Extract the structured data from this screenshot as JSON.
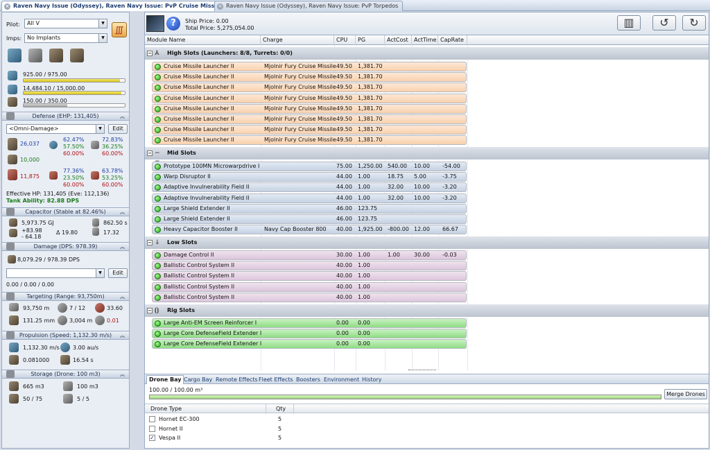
{
  "tabs": [
    {
      "label": "Raven Navy Issue (Odyssey), Raven Navy Issue: PvP Cruise Missiles",
      "active": true
    },
    {
      "label": "Raven Navy Issue (Odyssey), Raven Navy Issue: PvP Torpedos",
      "active": false
    }
  ],
  "left": {
    "pilot_label": "Pilot:",
    "pilot_value": "All V",
    "imps_label": "Imps:",
    "imps_value": "No Implants",
    "cpu": "925.00 / 975.00",
    "cpu_fill": 0.949,
    "pg": "14,484.10 / 15,000.00",
    "pg_fill": 0.966,
    "calibration": "150.00 / 350.00",
    "calibration_fill": 0.429,
    "defense": {
      "header": "Defense (EHP: 131,405)",
      "profile": "<Omni-Damage>",
      "edit_label": "Edit",
      "shield_hp": "26,037",
      "shield_em": "62.47%",
      "shield_th": "57.50%",
      "shield_ki": "60.00%",
      "shield_ex": "72.83%",
      "shield_ex2": "36.25%",
      "shield_ex3": "60.00%",
      "armor_hp": "10,000",
      "hull_hp": "11,875",
      "hull_a": "77.36%",
      "hull_b": "23.50%",
      "hull_c": "60.00%",
      "hull_d": "63.78%",
      "hull_e": "53.25%",
      "hull_f": "60.00%",
      "effective": "Effective HP: 131,405 (Eve: 112,136)",
      "tank": "Tank Ability: 82.88 DPS"
    },
    "capacitor": {
      "header": "Capacitor (Stable at 82.46%)",
      "capacity": "5,973.75 GJ",
      "recharge": "862.50 s",
      "delta_pos": "+83.98",
      "delta_neg": "- 64.18",
      "delta": "Δ 19.80",
      "other": "17.32"
    },
    "damage": {
      "header": "Damage (DPS: 978.39)",
      "dps": "8,079.29 / 978.39 DPS",
      "edit_label": "Edit",
      "secondary": "0.00 / 0.00 / 0.00"
    },
    "targeting": {
      "header": "Targeting (Range: 93,750m)",
      "range": "93,750 m",
      "targets": "7 / 12",
      "sensor": "33.60",
      "scan_res": "131.25 mm",
      "sig": "3,004 m",
      "sig_rate": "0.01"
    },
    "propulsion": {
      "header": "Propulsion (Speed: 1,132.30 m/s)",
      "speed": "1,132.30 m/s",
      "warp": "3.00 au/s",
      "agility": "0.081000",
      "align": "16.54 s"
    },
    "storage": {
      "header": "Storage (Drone: 100 m3)",
      "cargo": "665 m3",
      "drone_bay": "100 m3",
      "bandwidth": "50 / 75",
      "drones": "5 / 5"
    }
  },
  "right": {
    "ship_price": "Ship Price: 0.00",
    "total_price": "Total Price: 5,275,054.00",
    "columns": [
      "Module Name",
      "Charge",
      "CPU",
      "PG",
      "ActCost",
      "ActTime",
      "CapRate"
    ],
    "high_header": "High Slots (Launchers: 8/8, Turrets: 0/0)",
    "mid_header": "Mid Slots",
    "low_header": "Low Slots",
    "rig_header": "Rig Slots",
    "high": [
      {
        "name": "Cruise Missile Launcher II",
        "charge": "Mjolnir Fury Cruise Missile",
        "cpu": "49.50",
        "pg": "1,381.70",
        "cost": "",
        "time": "",
        "rate": ""
      },
      {
        "name": "Cruise Missile Launcher II",
        "charge": "Mjolnir Fury Cruise Missile",
        "cpu": "49.50",
        "pg": "1,381.70",
        "cost": "",
        "time": "",
        "rate": ""
      },
      {
        "name": "Cruise Missile Launcher II",
        "charge": "Mjolnir Fury Cruise Missile",
        "cpu": "49.50",
        "pg": "1,381.70",
        "cost": "",
        "time": "",
        "rate": ""
      },
      {
        "name": "Cruise Missile Launcher II",
        "charge": "Mjolnir Fury Cruise Missile",
        "cpu": "49.50",
        "pg": "1,381.70",
        "cost": "",
        "time": "",
        "rate": ""
      },
      {
        "name": "Cruise Missile Launcher II",
        "charge": "Mjolnir Fury Cruise Missile",
        "cpu": "49.50",
        "pg": "1,381.70",
        "cost": "",
        "time": "",
        "rate": ""
      },
      {
        "name": "Cruise Missile Launcher II",
        "charge": "Mjolnir Fury Cruise Missile",
        "cpu": "49.50",
        "pg": "1,381.70",
        "cost": "",
        "time": "",
        "rate": ""
      },
      {
        "name": "Cruise Missile Launcher II",
        "charge": "Mjolnir Fury Cruise Missile",
        "cpu": "49.50",
        "pg": "1,381.70",
        "cost": "",
        "time": "",
        "rate": ""
      },
      {
        "name": "Cruise Missile Launcher II",
        "charge": "Mjolnir Fury Cruise Missile",
        "cpu": "49.50",
        "pg": "1,381.70",
        "cost": "",
        "time": "",
        "rate": ""
      }
    ],
    "mid": [
      {
        "name": "Prototype 100MN Microwarpdrive I",
        "charge": "",
        "cpu": "75.00",
        "pg": "1,250.00",
        "cost": "540.00",
        "time": "10.00",
        "rate": "-54.00"
      },
      {
        "name": "Warp Disruptor II",
        "charge": "",
        "cpu": "44.00",
        "pg": "1.00",
        "cost": "18.75",
        "time": "5.00",
        "rate": "-3.75"
      },
      {
        "name": "Adaptive Invulnerability Field II",
        "charge": "",
        "cpu": "44.00",
        "pg": "1.00",
        "cost": "32.00",
        "time": "10.00",
        "rate": "-3.20"
      },
      {
        "name": "Adaptive Invulnerability Field II",
        "charge": "",
        "cpu": "44.00",
        "pg": "1.00",
        "cost": "32.00",
        "time": "10.00",
        "rate": "-3.20"
      },
      {
        "name": "Large Shield Extender II",
        "charge": "",
        "cpu": "46.00",
        "pg": "123.75",
        "cost": "",
        "time": "",
        "rate": ""
      },
      {
        "name": "Large Shield Extender II",
        "charge": "",
        "cpu": "46.00",
        "pg": "123.75",
        "cost": "",
        "time": "",
        "rate": ""
      },
      {
        "name": "Heavy Capacitor Booster II",
        "charge": "Navy Cap Booster 800",
        "cpu": "40.00",
        "pg": "1,925.00",
        "cost": "-800.00",
        "time": "12.00",
        "rate": "66.67"
      }
    ],
    "low": [
      {
        "name": "Damage Control II",
        "charge": "",
        "cpu": "30.00",
        "pg": "1.00",
        "cost": "1.00",
        "time": "30.00",
        "rate": "-0.03"
      },
      {
        "name": "Ballistic Control System II",
        "charge": "",
        "cpu": "40.00",
        "pg": "1.00",
        "cost": "",
        "time": "",
        "rate": ""
      },
      {
        "name": "Ballistic Control System II",
        "charge": "",
        "cpu": "40.00",
        "pg": "1.00",
        "cost": "",
        "time": "",
        "rate": ""
      },
      {
        "name": "Ballistic Control System II",
        "charge": "",
        "cpu": "40.00",
        "pg": "1.00",
        "cost": "",
        "time": "",
        "rate": ""
      },
      {
        "name": "Ballistic Control System II",
        "charge": "",
        "cpu": "40.00",
        "pg": "1.00",
        "cost": "",
        "time": "",
        "rate": ""
      }
    ],
    "rig": [
      {
        "name": "Large Anti-EM Screen Reinforcer I",
        "charge": "",
        "cpu": "0.00",
        "pg": "0.00",
        "cost": "",
        "time": "",
        "rate": ""
      },
      {
        "name": "Large Core DefenseField Extender I",
        "charge": "",
        "cpu": "0.00",
        "pg": "0.00",
        "cost": "",
        "time": "",
        "rate": ""
      },
      {
        "name": "Large Core DefenseField Extender I",
        "charge": "",
        "cpu": "0.00",
        "pg": "0.00",
        "cost": "",
        "time": "",
        "rate": ""
      }
    ],
    "bottom_tabs": [
      "Drone Bay",
      "Cargo Bay",
      "Remote Effects",
      "Fleet Effects",
      "Boosters",
      "Environment",
      "History"
    ],
    "drone_bay": {
      "capacity": "100.00 / 100.00 m³",
      "capacity_fill": 1.0,
      "merge_label": "Merge Drones",
      "col_type": "Drone Type",
      "col_qty": "Qty",
      "drones": [
        {
          "name": "Hornet EC-300",
          "qty": "5",
          "checked": false
        },
        {
          "name": "Hornet II",
          "qty": "5",
          "checked": false
        },
        {
          "name": "Vespa II",
          "qty": "5",
          "checked": true
        }
      ]
    }
  }
}
